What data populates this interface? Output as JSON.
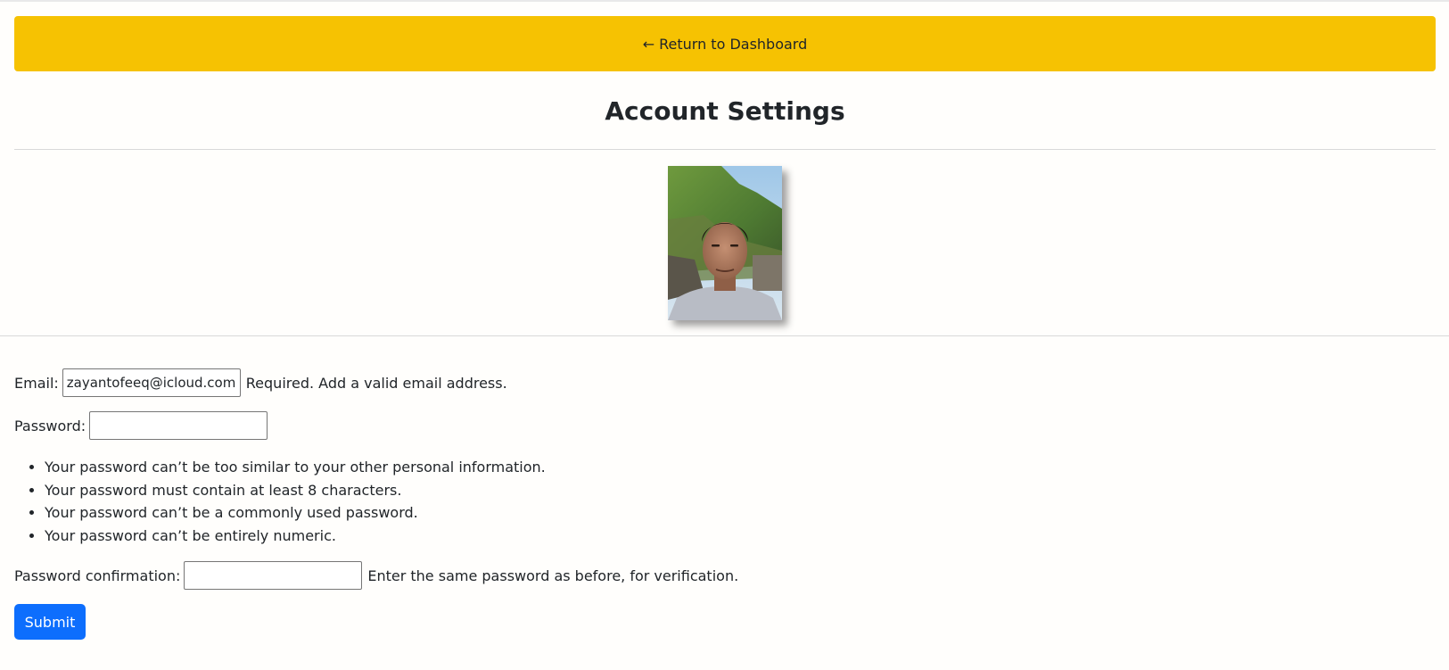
{
  "nav": {
    "arrow": "←",
    "return_label": "Return to Dashboard",
    "button_color": "#f6c202"
  },
  "page": {
    "title": "Account Settings"
  },
  "profile": {
    "avatar_alt": "profile photo"
  },
  "form": {
    "email": {
      "label": "Email:",
      "value": "zayantofeeq@icloud.com",
      "help": "Required. Add a valid email address."
    },
    "password": {
      "label": "Password:",
      "value": "",
      "rules": [
        "Your password can’t be too similar to your other personal information.",
        "Your password must contain at least 8 characters.",
        "Your password can’t be a commonly used password.",
        "Your password can’t be entirely numeric."
      ]
    },
    "password_confirmation": {
      "label": "Password confirmation:",
      "value": "",
      "help": "Enter the same password as before, for verification."
    },
    "submit_label": "Submit",
    "submit_color": "#0d6efd"
  }
}
